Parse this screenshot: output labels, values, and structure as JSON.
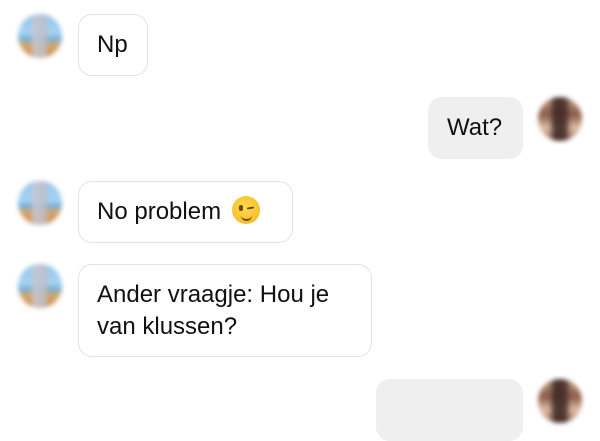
{
  "messages": [
    {
      "side": "in",
      "text": "Np"
    },
    {
      "side": "out",
      "text": "Wat?"
    },
    {
      "side": "in",
      "text": "No problem",
      "emoji": "winking-face"
    },
    {
      "side": "in",
      "text": "Ander vraagje: Hou je van klussen?"
    },
    {
      "side": "out",
      "text": ""
    }
  ],
  "colors": {
    "incoming_bg": "#ffffff",
    "incoming_border": "#e2e2e2",
    "outgoing_bg": "#efefef",
    "text": "#111111"
  }
}
